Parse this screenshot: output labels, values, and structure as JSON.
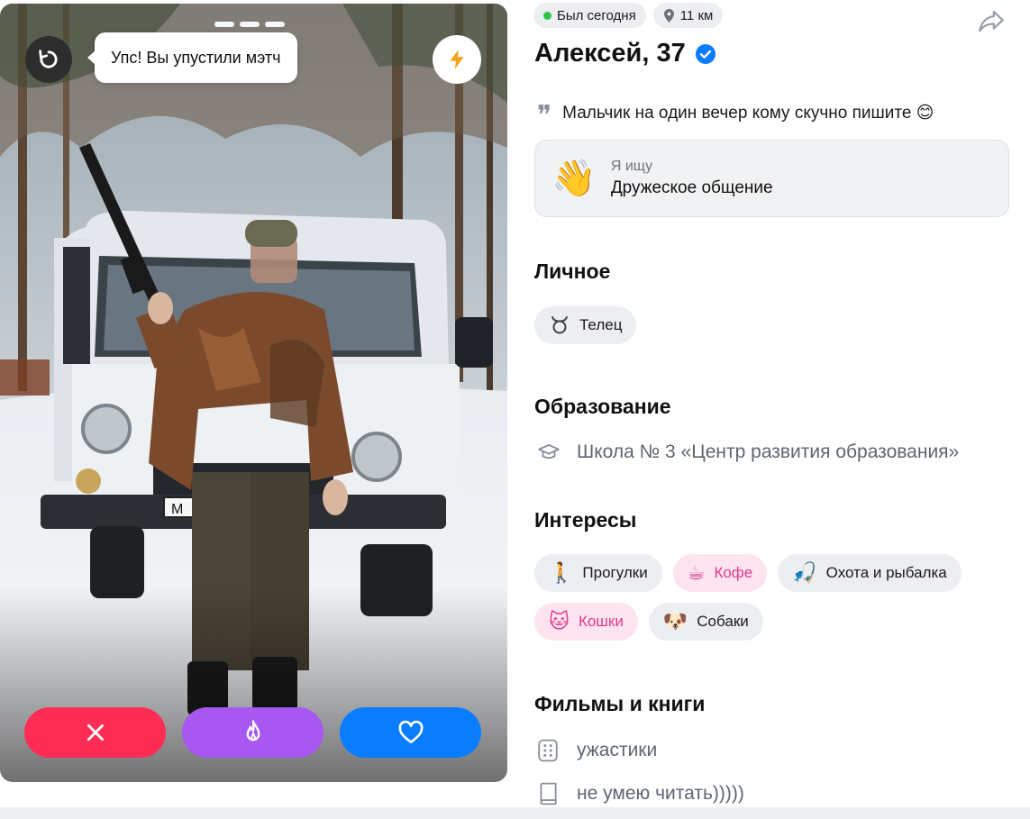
{
  "photo": {
    "tooltip": "Упс! Вы упустили мэтч",
    "license_plate": "M"
  },
  "icons": {
    "undo": "undo-arrow-icon",
    "boost": "lightning-icon",
    "dislike": "close-icon",
    "superlike": "flame-icon",
    "like": "heart-icon",
    "share": "share-arrow-icon",
    "verified": "verified-check-icon",
    "location": "location-pin-icon",
    "quote": "quote-icon",
    "zodiac": "taurus-icon",
    "education": "graduation-cap-icon",
    "film": "dice-icon",
    "book": "book-icon"
  },
  "colors": {
    "online": "#2fc44b",
    "dislike": "#ff2d55",
    "superlike": "#a857f0",
    "like": "#0a7cff",
    "verified": "#0a7cff",
    "pink_chip_text": "#e2398a"
  },
  "profile": {
    "status": "Был сегодня",
    "distance": "11 км",
    "name_age": "Алексей, 37",
    "bio": "Мальчик на один вечер кому скучно пишите 😊",
    "seeking_label": "Я ищу",
    "seeking_value": "Дружеское общение",
    "seeking_emoji": "👋"
  },
  "sections": {
    "personal": {
      "title": "Личное",
      "zodiac": "Телец"
    },
    "education": {
      "title": "Образование",
      "school": "Школа № 3 «Центр развития образования»"
    },
    "interests": {
      "title": "Интересы",
      "items": [
        {
          "emoji": "🚶",
          "label": "Прогулки",
          "highlight": false
        },
        {
          "emoji": "☕",
          "label": "Кофе",
          "highlight": true
        },
        {
          "emoji": "🎣",
          "label": "Охота и рыбалка",
          "highlight": false
        },
        {
          "emoji": "🐱",
          "label": "Кошки",
          "highlight": true
        },
        {
          "emoji": "🐶",
          "label": "Собаки",
          "highlight": false
        }
      ]
    },
    "films_books": {
      "title": "Фильмы и книги",
      "film": "ужастики",
      "book": "не умею читать)))))"
    }
  }
}
